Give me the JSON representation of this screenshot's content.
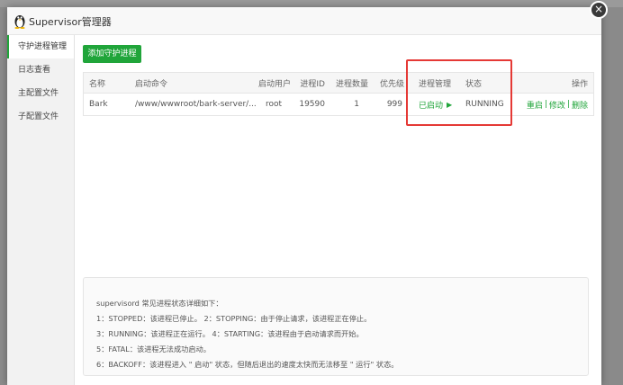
{
  "dialog": {
    "title": "Supervisor管理器",
    "close_glyph": "×"
  },
  "sidebar": {
    "items": [
      {
        "label": "守护进程管理"
      },
      {
        "label": "日志查看"
      },
      {
        "label": "主配置文件"
      },
      {
        "label": "子配置文件"
      }
    ]
  },
  "toolbar": {
    "add_label": "添加守护进程"
  },
  "table": {
    "headers": {
      "name": "名称",
      "command": "启动命令",
      "user": "启动用户",
      "pid": "进程ID",
      "count": "进程数量",
      "priority": "优先级",
      "manage": "进程管理",
      "status": "状态",
      "ops": "操作"
    },
    "rows": [
      {
        "name": "Bark",
        "command": "/www/wwwroot/bark-server/...",
        "user": "root",
        "pid": "19590",
        "count": "1",
        "priority": "999",
        "manage": "已启动",
        "status": "RUNNING",
        "op_restart": "重启",
        "op_edit": "修改",
        "op_delete": "删除"
      }
    ]
  },
  "info": {
    "lines": [
      "supervisord 常见进程状态详细如下：",
      "1：STOPPED：该进程已停止。      2：STOPPING：由于停止请求，该进程正在停止。",
      "3：RUNNING：该进程正在运行。  4：STARTING：该进程由于启动请求而开始。",
      "5：FATAL：该进程无法成功启动。",
      "6：BACKOFF：该进程进入 \" 启动\" 状态，但随后退出的速度太快而无法移至 \" 运行\" 状态。"
    ]
  },
  "colors": {
    "accent": "#20a53a",
    "highlight": "#e53935"
  }
}
